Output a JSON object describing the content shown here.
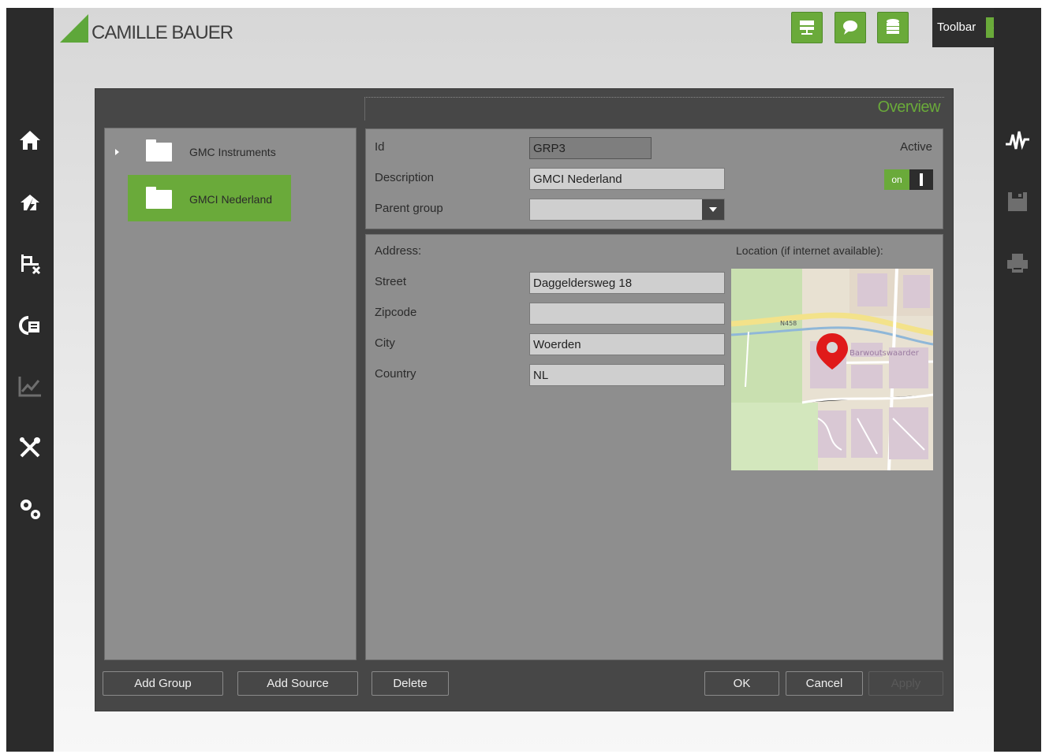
{
  "app": {
    "logo_text": "CAMILLE BAUER"
  },
  "header": {
    "toolbar_label": "Toolbar",
    "toolbar_toggle": "on",
    "icons": [
      "network-icon",
      "chat-icon",
      "database-icon"
    ]
  },
  "left_nav": {
    "icons": [
      "home-icon",
      "alarm-icon",
      "topology-icon",
      "dashboard-icon",
      "chart-icon",
      "tools-icon",
      "settings-icon"
    ]
  },
  "right_nav": {
    "icons": [
      "waveform-icon",
      "save-icon",
      "print-icon"
    ]
  },
  "colors": {
    "accent": "#6aaa3a",
    "dark": "#2b2b2b",
    "panel": "#8e8e8e",
    "dialog": "#474747"
  },
  "tree": {
    "items": [
      {
        "label": "GMC Instruments",
        "selected": false
      },
      {
        "label": "GMCI Nederland",
        "selected": true
      }
    ]
  },
  "overview": {
    "title": "Overview"
  },
  "form": {
    "id_label": "Id",
    "id_value": "GRP3",
    "description_label": "Description",
    "description_value": "GMCI Nederland",
    "parent_group_label": "Parent group",
    "parent_group_value": "",
    "active_label": "Active",
    "active_toggle": "on",
    "address_label": "Address:",
    "location_label": "Location (if internet available):",
    "street_label": "Street",
    "street_value": "Daggeldersweg 18",
    "zipcode_label": "Zipcode",
    "zipcode_value": "",
    "city_label": "City",
    "city_value": "Woerden",
    "country_label": "Country",
    "country_value": "NL"
  },
  "map": {
    "road_label": "N458",
    "district_label": "Barwoutswaarder"
  },
  "buttons": {
    "add_group": "Add Group",
    "add_source": "Add Source",
    "delete": "Delete",
    "ok": "OK",
    "cancel": "Cancel",
    "apply": "Apply"
  }
}
